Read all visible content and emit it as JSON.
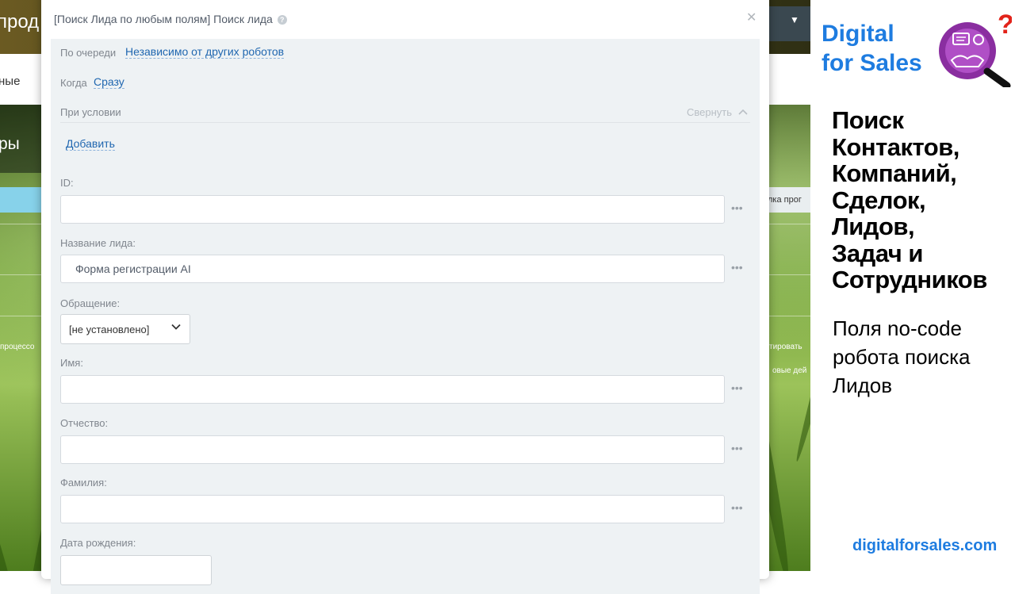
{
  "background": {
    "topbar_text": "прод",
    "nav_text": "ные",
    "panel_text": "ры",
    "right_tab_text": "лка прог",
    "left_side_text": "процессо",
    "right_side_text_1": "тировать",
    "right_side_text_2": "овые дей"
  },
  "dialog": {
    "title": "[Поиск Лида по любым полям] Поиск лида",
    "queue_label": "По очереди",
    "queue_value": "Независимо от других роботов",
    "when_label": "Когда",
    "when_value": "Сразу",
    "condition_label": "При условии",
    "collapse_label": "Свернуть",
    "add_label": "Добавить",
    "fields": {
      "id_label": "ID:",
      "id_value": "",
      "title_label": "Название лида:",
      "title_value": "Форма регистрации AI",
      "honorific_label": "Обращение:",
      "honorific_value": "[не установлено]",
      "name_label": "Имя:",
      "name_value": "",
      "middle_name_label": "Отчество:",
      "middle_name_value": "",
      "last_name_label": "Фамилия:",
      "last_name_value": "",
      "birthdate_label": "Дата рождения:"
    },
    "more_dots": "•••"
  },
  "promo": {
    "brand_line1": "Digital",
    "brand_line2": "for Sales",
    "headline": "Поиск\nКонтактов,\nКомпаний,\nСделок,\nЛидов,\nЗадач и\nСотрудников",
    "subtitle": "Поля no-code\nробота поиска\nЛидов",
    "website": "digitalforsales.com"
  },
  "colors": {
    "brand_blue": "#1e7ce0",
    "link_blue": "#2067b0",
    "panel_bg": "#eef2f4",
    "logo_purple": "#8a2ea0",
    "logo_red": "#e2231a"
  }
}
